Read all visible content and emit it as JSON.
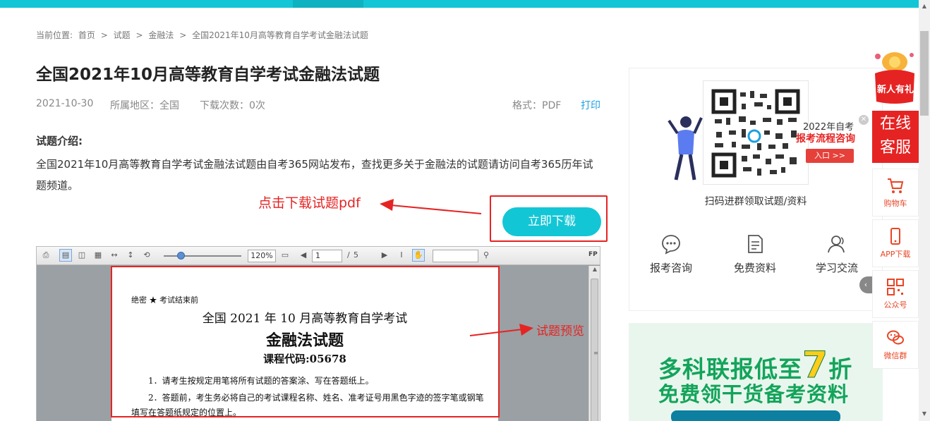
{
  "breadcrumb": {
    "prefix": "当前位置:",
    "items": [
      "首页",
      "试题",
      "金融法",
      "全国2021年10月高等教育自学考试金融法试题"
    ],
    "sep": ">"
  },
  "title": "全国2021年10月高等教育自学考试金融法试题",
  "meta": {
    "date": "2021-10-30",
    "region": "所属地区：全国",
    "downloads": "下载次数：0次",
    "format": "格式：PDF",
    "print": "打印"
  },
  "intro": {
    "label": "试题介绍:",
    "text": "全国2021年10月高等教育自学考试金融法试题由自考365网站发布，查找更多关于金融法的试题请访问自考365历年试题频道。"
  },
  "annotations": {
    "download": "点击下载试题pdf",
    "preview": "试题预览"
  },
  "download_button": "立即下载",
  "viewer": {
    "zoom": "120%",
    "page": "1",
    "page_sep": "/",
    "page_total": "5",
    "fp": "FP",
    "doc": {
      "line1": "绝密 ★ 考试结束前",
      "line2": "全国 2021 年 10 月高等教育自学考试",
      "line3": "金融法试题",
      "line4": "课程代码:05678",
      "line5": "1．请考生按规定用笔将所有试题的答案涂、写在答题纸上。",
      "line6": "2．答题前，考生务必将自己的考试课程名称、姓名、准考证号用黑色字迹的签字笔或钢笔",
      "line7": "填写在答题纸规定的位置上。"
    }
  },
  "qr_panel": {
    "caption": "扫码进群领取试题/资料",
    "promo_year": "2022年自考",
    "promo_title": "报考流程咨询",
    "promo_button": "入口 >>",
    "services": [
      "报考咨询",
      "免费资料",
      "学习交流"
    ]
  },
  "banner": {
    "line1_a": "多科联报低至",
    "line1_num": "7",
    "line1_b": "折",
    "line2": "免费领干货备考资料"
  },
  "sidebar": {
    "gift": "新人有礼",
    "online_1": "在线",
    "online_2": "客服",
    "items": [
      "购物车",
      "APP下载",
      "公众号",
      "微信群"
    ]
  },
  "colors": {
    "accent": "#13c6d6",
    "red": "#e62323",
    "link": "#1ca0e2"
  }
}
